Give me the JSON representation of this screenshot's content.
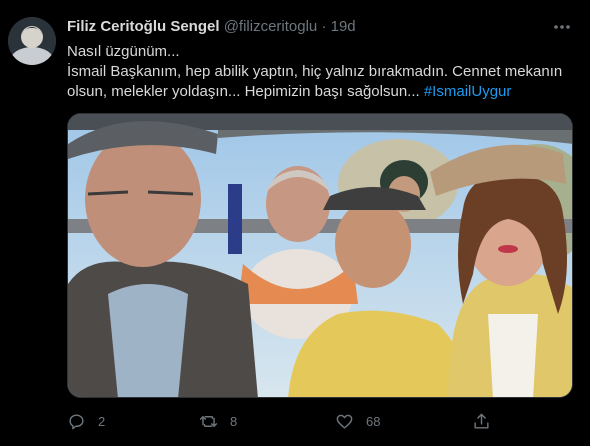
{
  "tweet": {
    "author_name": "Filiz Ceritoğlu Sengel",
    "author_handle": "@filizceritoglu",
    "separator": "·",
    "time": "19d",
    "text_line_1": "Nasıl üzgünüm...",
    "text_line_2": "İsmail Başkanım, hep abilik yaptın, hiç yalnız bırakmadın. Cennet mekanın",
    "text_line_3": "olsun, melekler yoldaşın... Hepimizin başı sağolsun...",
    "hashtag": "#IsmailUygur"
  },
  "actions": {
    "reply_count": "2",
    "retweet_count": "8",
    "like_count": "68"
  },
  "icons": {
    "more": "more-icon",
    "reply": "reply-icon",
    "retweet": "retweet-icon",
    "like": "like-icon",
    "share": "share-icon"
  },
  "colors": {
    "background": "#000000",
    "text": "#d9d9d9",
    "secondary": "#6e767d",
    "link": "#1d9bf0"
  }
}
